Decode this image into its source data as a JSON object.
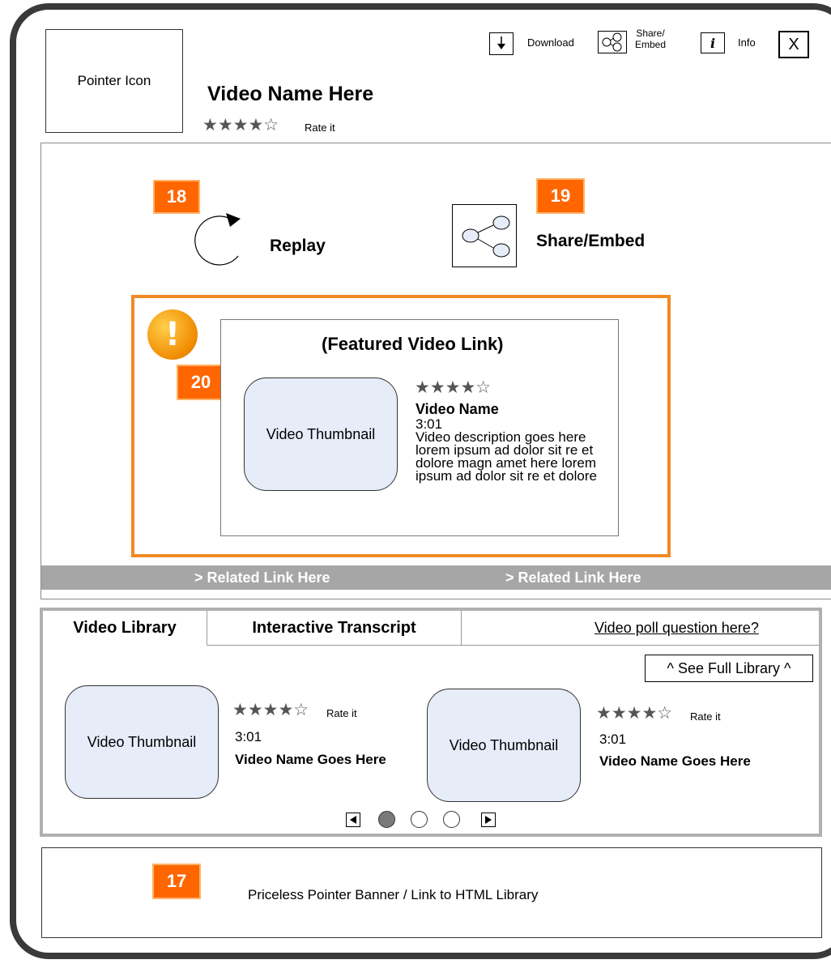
{
  "header": {
    "pointer_icon_label": "Pointer Icon",
    "video_title": "Video Name Here",
    "stars": "★★★★☆",
    "rate_label": "Rate it",
    "toolbar": {
      "download_label": "Download",
      "share_label": "Share/\nEmbed",
      "info_glyph": "i",
      "info_label": "Info",
      "close_label": "X"
    }
  },
  "player": {
    "badges": {
      "replay": "18",
      "share": "19",
      "featured": "20",
      "banner": "17"
    },
    "replay_label": "Replay",
    "share_embed_label": "Share/Embed",
    "alert_glyph": "!",
    "featured": {
      "title": "(Featured Video Link)",
      "thumbnail_label": "Video Thumbnail",
      "stars": "★★★★☆",
      "video_name": "Video Name",
      "duration": "3:01",
      "description": "Video description goes here lorem ipsum ad dolor sit re et dolore magn amet here lorem ipsum ad dolor sit re et dolore"
    },
    "related_links": [
      "> Related Link Here",
      "> Related Link Here"
    ]
  },
  "library": {
    "tabs": [
      "Video Library",
      "Interactive Transcript"
    ],
    "poll_link": "Video poll question here?",
    "full_library_button": "^ See Full Library ^",
    "items": [
      {
        "thumbnail_label": "Video Thumbnail",
        "stars": "★★★★☆",
        "rate_label": "Rate it",
        "duration": "3:01",
        "name": "Video Name Goes Here"
      },
      {
        "thumbnail_label": "Video Thumbnail",
        "stars": "★★★★☆",
        "rate_label": "Rate it",
        "duration": "3:01",
        "name": "Video Name Goes Here"
      }
    ],
    "pager": {
      "current_page": 1,
      "total_pages": 3
    }
  },
  "banner": {
    "text": "Priceless Pointer Banner / Link to HTML Library"
  },
  "colors": {
    "badge": "#ff6600",
    "featured_border": "#f08a24",
    "related_bar": "#a6a6a6",
    "thumbnail_fill": "#e6ecf8"
  }
}
